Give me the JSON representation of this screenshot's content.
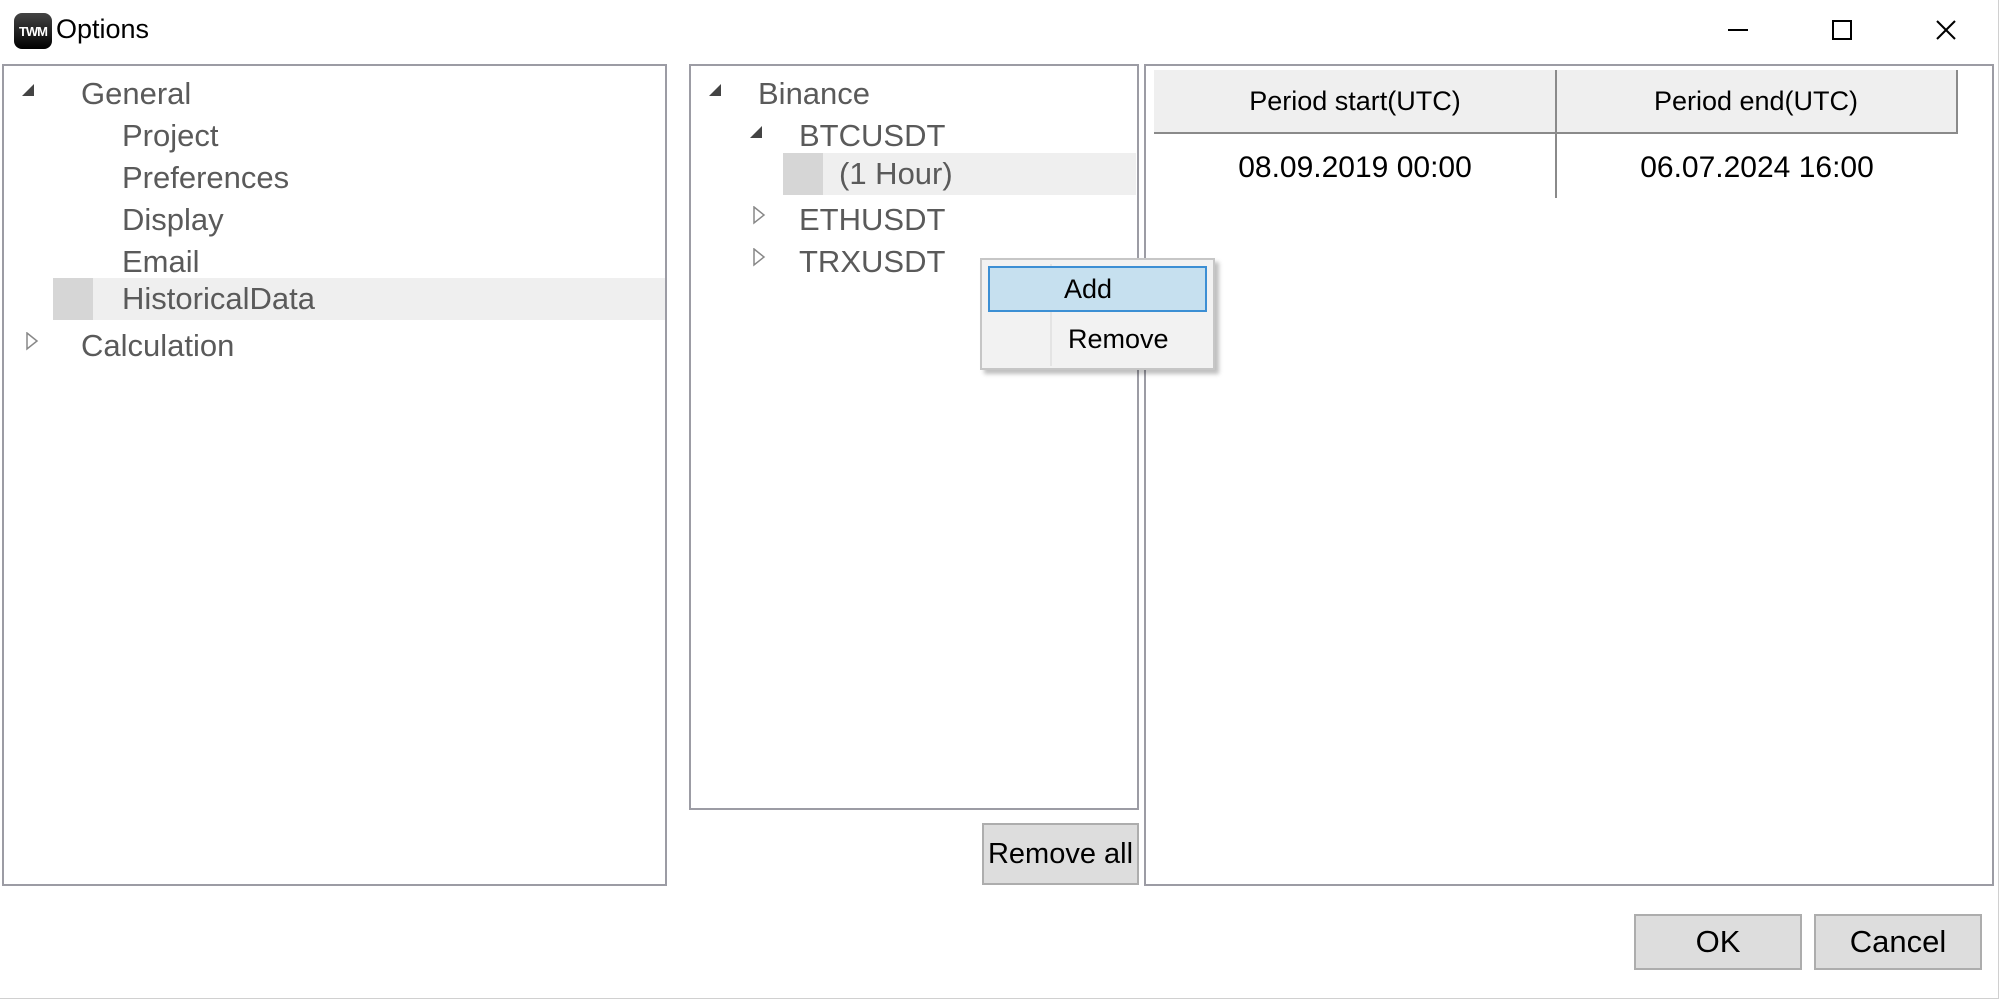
{
  "window": {
    "title": "Options",
    "app_icon_text": "TWM",
    "controls": {
      "minimize": "minimize-icon",
      "maximize": "maximize-icon",
      "close": "close-icon"
    }
  },
  "settings_tree": {
    "items": [
      {
        "label": "General",
        "level": 0,
        "expander": "expanded"
      },
      {
        "label": "Project",
        "level": 1
      },
      {
        "label": "Preferences",
        "level": 1
      },
      {
        "label": "Display",
        "level": 1
      },
      {
        "label": "Email",
        "level": 1
      },
      {
        "label": "HistoricalData",
        "level": 1,
        "selected": true
      },
      {
        "label": "Calculation",
        "level": 0,
        "expander": "collapsed"
      }
    ]
  },
  "data_tree": {
    "items": [
      {
        "label": "Binance",
        "level": 0,
        "expander": "expanded"
      },
      {
        "label": "BTCUSDT",
        "level": 1,
        "expander": "expanded"
      },
      {
        "label": "(1 Hour)",
        "level": 2,
        "selected": true
      },
      {
        "label": "ETHUSDT",
        "level": 1,
        "expander": "collapsed"
      },
      {
        "label": "TRXUSDT",
        "level": 1,
        "expander": "collapsed"
      }
    ]
  },
  "context_menu": {
    "items": [
      {
        "label": "Add",
        "highlighted": true
      },
      {
        "label": "Remove",
        "highlighted": false
      }
    ]
  },
  "period_grid": {
    "columns": [
      "Period start(UTC)",
      "Period end(UTC)"
    ],
    "rows": [
      [
        "08.09.2019 00:00",
        "06.07.2024 16:00"
      ]
    ]
  },
  "buttons": {
    "remove_all": "Remove all",
    "ok": "OK",
    "cancel": "Cancel"
  },
  "colors": {
    "selection_background": "#efefef",
    "menu_highlight": "#c6e0ef",
    "menu_highlight_border": "#3c8fd4",
    "panel_border": "#9c9ca4"
  }
}
